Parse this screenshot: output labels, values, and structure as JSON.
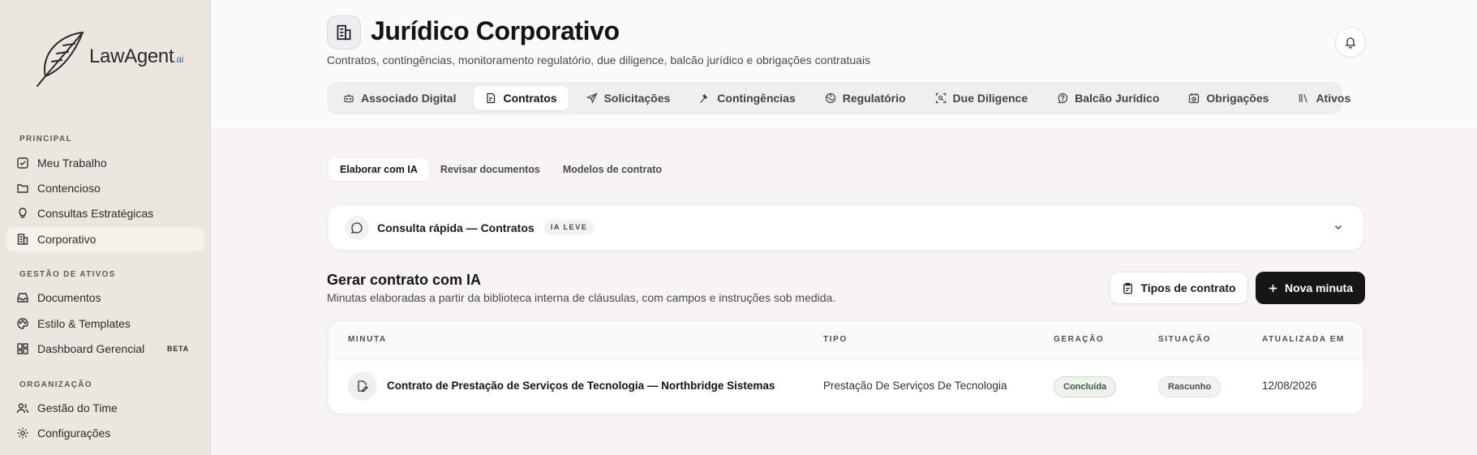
{
  "brand": {
    "name": "LawAgent",
    "suffix": ".ai"
  },
  "sidebar": {
    "sections": [
      {
        "label": "PRINCIPAL"
      },
      {
        "label": "GESTÃO DE ATIVOS"
      },
      {
        "label": "ORGANIZAÇÃO"
      }
    ],
    "items": [
      {
        "label": "Meu Trabalho",
        "icon": "checkbox-icon"
      },
      {
        "label": "Contencioso",
        "icon": "folder-icon"
      },
      {
        "label": "Consultas Estratégicas",
        "icon": "lightbulb-icon"
      },
      {
        "label": "Corporativo",
        "icon": "building-icon",
        "active": true
      },
      {
        "label": "Documentos",
        "icon": "inbox-icon"
      },
      {
        "label": "Estilo & Templates",
        "icon": "palette-icon"
      },
      {
        "label": "Dashboard Gerencial",
        "icon": "dashboard-icon",
        "badge": "BETA"
      },
      {
        "label": "Gestão do Time",
        "icon": "users-icon"
      },
      {
        "label": "Configurações",
        "icon": "gear-icon"
      }
    ]
  },
  "header": {
    "title": "Jurídico Corporativo",
    "subtitle": "Contratos, contingências, monitoramento regulatório, due diligence, balcão jurídico e obrigações contratuais",
    "tabs": [
      {
        "label": "Associado Digital",
        "icon": "robot-icon"
      },
      {
        "label": "Contratos",
        "icon": "contract-icon",
        "active": true
      },
      {
        "label": "Solicitações",
        "icon": "send-icon"
      },
      {
        "label": "Contingências",
        "icon": "gavel-icon"
      },
      {
        "label": "Regulatório",
        "icon": "globe-icon"
      },
      {
        "label": "Due Diligence",
        "icon": "scan-icon"
      },
      {
        "label": "Balcão Jurídico",
        "icon": "help-icon"
      },
      {
        "label": "Obrigações",
        "icon": "calendar-clock-icon"
      },
      {
        "label": "Ativos",
        "icon": "library-icon"
      }
    ]
  },
  "subtabs": [
    {
      "label": "Elaborar com IA",
      "active": true
    },
    {
      "label": "Revisar documentos"
    },
    {
      "label": "Modelos de contrato"
    }
  ],
  "consult": {
    "title": "Consulta rápida — Contratos",
    "badge": "IA LEVE"
  },
  "generate": {
    "title": "Gerar contrato com IA",
    "subtitle": "Minutas elaboradas a partir da biblioteca interna de cláusulas, com campos e instruções sob medida.",
    "types_button": "Tipos de contrato",
    "new_button": "Nova minuta"
  },
  "table": {
    "columns": [
      "MINUTA",
      "TIPO",
      "GERAÇÃO",
      "SITUAÇÃO",
      "ATUALIZADA EM"
    ],
    "rows": [
      {
        "minuta": "Contrato de Prestação de Serviços de Tecnologia — Northbridge Sistemas",
        "tipo": "Prestação De Serviços De Tecnologia",
        "geracao": "Concluída",
        "situacao": "Rascunho",
        "atualizada": "12/08/2026"
      }
    ]
  }
}
